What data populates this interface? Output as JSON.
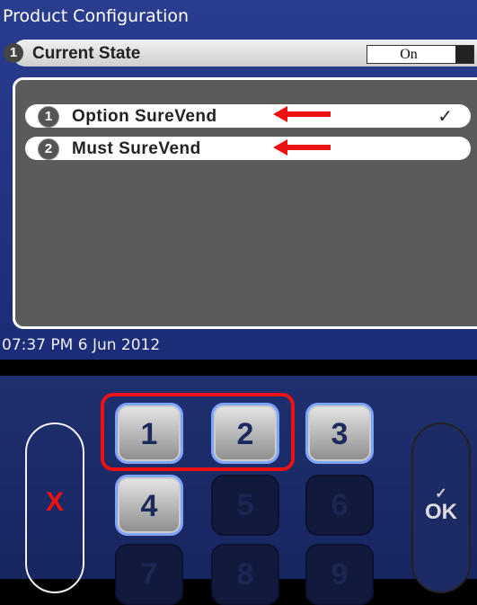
{
  "header": {
    "title": "Product Configuration"
  },
  "current_state": {
    "number": "1",
    "label": "Current State",
    "toggle_label": "On"
  },
  "options": [
    {
      "number": "1",
      "label": "Option SureVend",
      "check": "✓"
    },
    {
      "number": "2",
      "label": "Must SureVend",
      "check": ""
    }
  ],
  "status": {
    "datetime": "07:37 PM 6 Jun 2012"
  },
  "keypad": {
    "cancel_label": "X",
    "ok_label": "OK",
    "keys": [
      "1",
      "2",
      "3",
      "4",
      "5",
      "6",
      "7",
      "8",
      "9"
    ]
  },
  "colors": {
    "screen_bg": "#1b2c78",
    "annotation": "#e11111",
    "cancel": "#e11111",
    "active_key_border": "#7fa5ff"
  }
}
